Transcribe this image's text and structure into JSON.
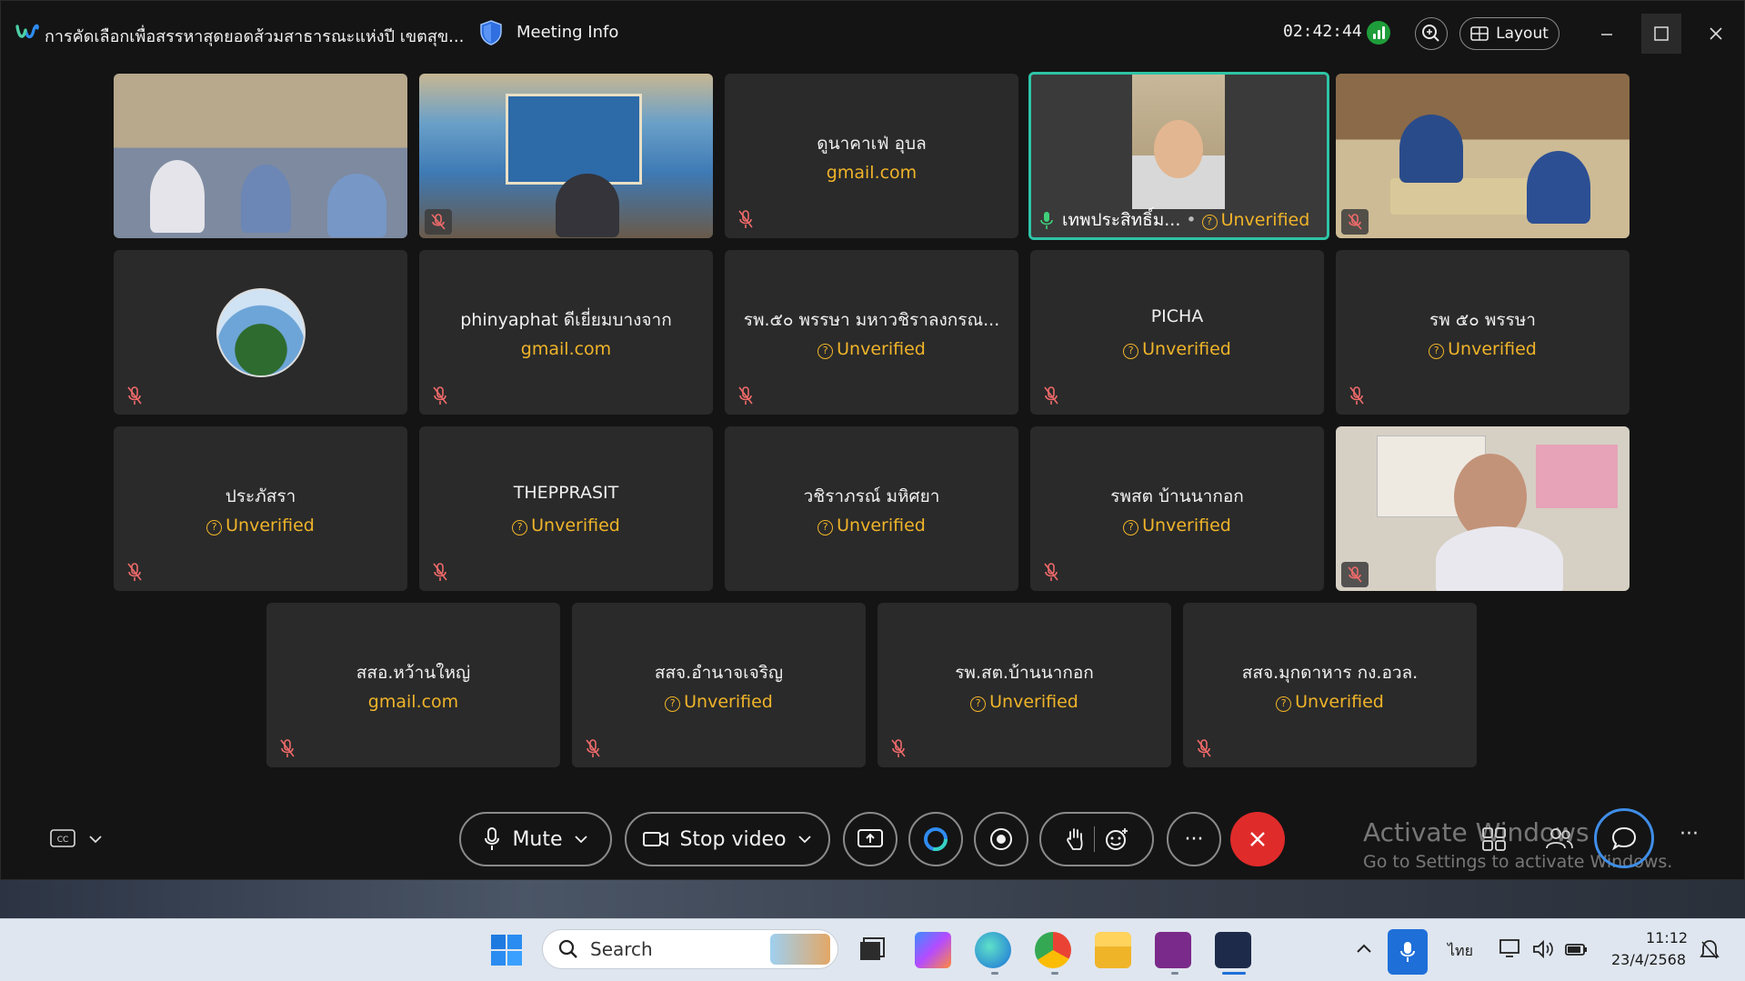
{
  "titlebar": {
    "meeting_title": "การคัดเลือกเพื่อสรรหาสุดยอดส้วมสาธารณะแห่งปี เขตสุข...",
    "meeting_info": "Meeting Info",
    "timer": "02:42:44",
    "layout_label": "Layout"
  },
  "tiles": [
    {
      "id": "t1",
      "type": "video"
    },
    {
      "id": "t2",
      "type": "video"
    },
    {
      "id": "t3",
      "name": "ดูนาคาเฟ่ อุบล",
      "sub": "gmail.com"
    },
    {
      "id": "t4",
      "type": "video",
      "name": "เทพประสิทธิ์ม...",
      "sub": "Unverified"
    },
    {
      "id": "t5",
      "type": "video"
    },
    {
      "id": "t6",
      "type": "avatar"
    },
    {
      "id": "t7",
      "name": "phinyaphat ดีเยี่ยมบางจาก",
      "sub": "gmail.com"
    },
    {
      "id": "t8",
      "name": "รพ.๕๐ พรรษา มหาวชิราลงกรณ...",
      "sub": "Unverified"
    },
    {
      "id": "t9",
      "name": "PICHA",
      "sub": "Unverified"
    },
    {
      "id": "t10",
      "name": "รพ ๕๐ พรรษา",
      "sub": "Unverified"
    },
    {
      "id": "t11",
      "name": "ประภัสรา",
      "sub": "Unverified"
    },
    {
      "id": "t12",
      "name": "THEPPRASIT",
      "sub": "Unverified"
    },
    {
      "id": "t13",
      "name": "วชิราภรณ์ มหิศยา",
      "sub": "Unverified"
    },
    {
      "id": "t14",
      "name": "รพสต บ้านนากอก",
      "sub": "Unverified"
    },
    {
      "id": "t15",
      "type": "video"
    },
    {
      "id": "t16",
      "name": "สสอ.หว้านใหญ่",
      "sub": "gmail.com"
    },
    {
      "id": "t17",
      "name": "สสจ.อำนาจเจริญ",
      "sub": "Unverified"
    },
    {
      "id": "t18",
      "name": "รพ.สต.บ้านนากอก",
      "sub": "Unverified"
    },
    {
      "id": "t19",
      "name": "สสจ.มุกดาหาร กง.อวล.",
      "sub": "Unverified"
    }
  ],
  "controls": {
    "mute_label": "Mute",
    "video_label": "Stop video",
    "more_label": "···"
  },
  "watermark": {
    "line1": "Activate Windows",
    "line2": "Go to Settings to activate Windows."
  },
  "taskbar": {
    "search_label": "Search",
    "language": "ไทย",
    "clock_time": "11:12",
    "clock_date": "23/4/2568"
  },
  "colors": {
    "accent_teal": "#2ec4a6",
    "unverified": "#f0b429",
    "end_call": "#e02b2b",
    "chat_ring": "#3f8ee8"
  }
}
